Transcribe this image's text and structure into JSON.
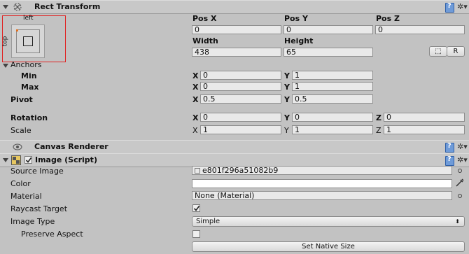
{
  "rect_transform": {
    "title": "Rect Transform",
    "anchor_preset": {
      "top_label": "left",
      "side_label": "top"
    },
    "pos_x_label": "Pos X",
    "pos_y_label": "Pos Y",
    "pos_z_label": "Pos Z",
    "pos_x": "0",
    "pos_y": "0",
    "pos_z": "0",
    "width_label": "Width",
    "height_label": "Height",
    "width": "438",
    "height": "65",
    "blueprint_btn": "⬚",
    "raw_btn": "R",
    "anchors_label": "Anchors",
    "min_label": "Min",
    "min_x": "0",
    "min_y": "1",
    "max_label": "Max",
    "max_x": "0",
    "max_y": "1",
    "pivot_label": "Pivot",
    "pivot_x": "0.5",
    "pivot_y": "0.5",
    "rotation_label": "Rotation",
    "rot_x": "0",
    "rot_y": "0",
    "rot_z": "0",
    "scale_label": "Scale",
    "scale_x": "1",
    "scale_y": "1",
    "scale_z": "1",
    "axis_x": "X",
    "axis_y": "Y",
    "axis_z": "Z"
  },
  "canvas_renderer": {
    "title": "Canvas Renderer"
  },
  "image_script": {
    "title": "Image (Script)",
    "enabled": true,
    "source_image_label": "Source Image",
    "source_image_value": "e801f296a51082b9",
    "color_label": "Color",
    "color_value": "#ffffff",
    "material_label": "Material",
    "material_value": "None (Material)",
    "raycast_label": "Raycast Target",
    "raycast_checked": true,
    "image_type_label": "Image Type",
    "image_type_value": "Simple",
    "preserve_aspect_label": "Preserve Aspect",
    "preserve_aspect_checked": false,
    "set_native_size_label": "Set Native Size"
  },
  "colors": {
    "accent_red": "#e02020",
    "help_blue": "#6f9bd8",
    "panel_bg": "#c2c2c2"
  }
}
